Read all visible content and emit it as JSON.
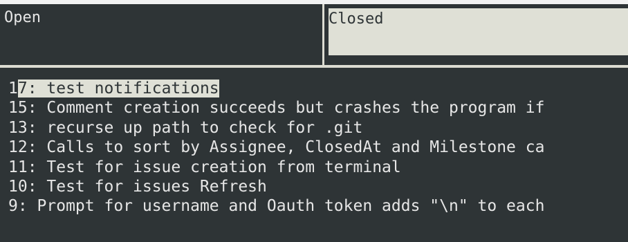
{
  "tabs": {
    "open_label": "Open",
    "closed_label": "Closed"
  },
  "issues": [
    {
      "label": "17: test notifications"
    },
    {
      "label": "15: Comment creation succeeds but crashes the program if"
    },
    {
      "label": "13: recurse up path to check for .git"
    },
    {
      "label": "12: Calls to sort by Assignee, ClosedAt and Milestone ca"
    },
    {
      "label": "11: Test for issue creation from terminal"
    },
    {
      "label": "10: Test for issues Refresh"
    },
    {
      "label": "9: Prompt for username and Oauth token adds \"\\n\" to each"
    }
  ],
  "selected_index": 0,
  "colors": {
    "background": "#2e3436",
    "foreground": "#e6e6e6",
    "highlight": "#dfe0d6"
  }
}
